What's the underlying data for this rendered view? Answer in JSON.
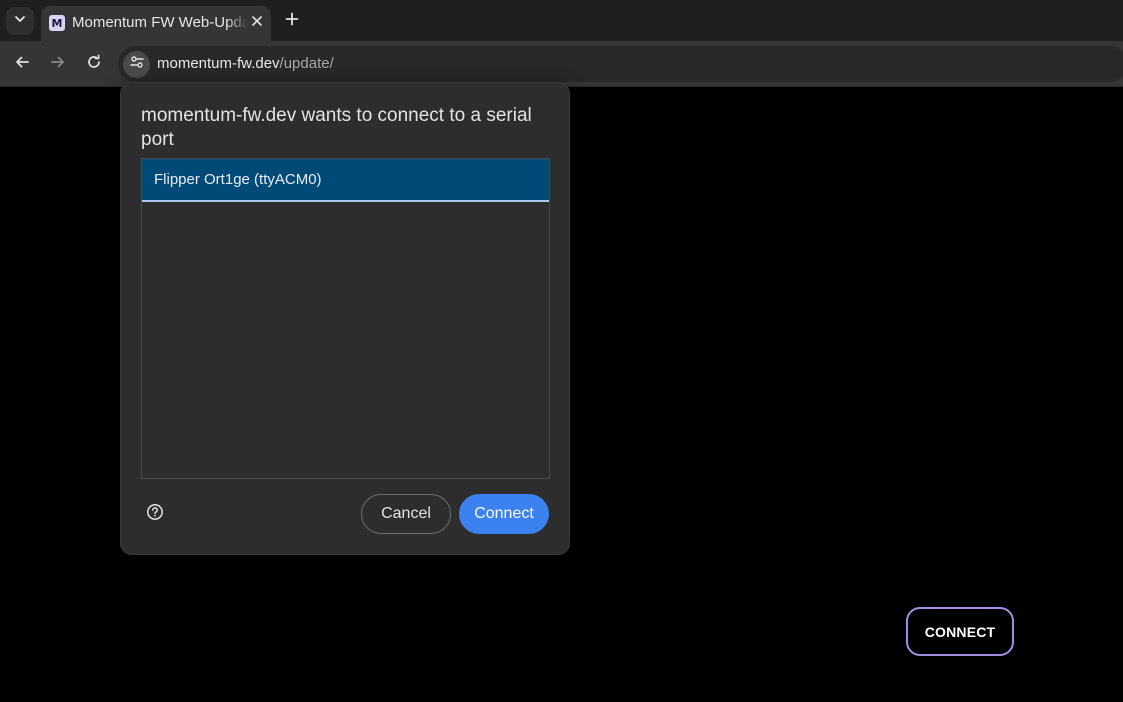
{
  "browser": {
    "tab": {
      "title": "Momentum FW Web-Updater",
      "favicon_letter": "M"
    },
    "address_bar": {
      "host": "momentum-fw.dev",
      "path": "/update/"
    }
  },
  "page": {
    "connect_button_label": "CONNECT"
  },
  "serial_dialog": {
    "title": "momentum-fw.dev wants to connect to a serial port",
    "ports": [
      {
        "label": "Flipper Ort1ge (ttyACM0)",
        "selected": true
      }
    ],
    "cancel_label": "Cancel",
    "connect_label": "Connect"
  },
  "colors": {
    "selected_row": "#004a77",
    "primary_button": "#3b82f0",
    "page_button_border": "#a48ee0"
  },
  "icons": [
    "chevron-down-icon",
    "favicon-icon",
    "close-icon",
    "plus-icon",
    "back-arrow-icon",
    "forward-arrow-icon",
    "reload-icon",
    "site-settings-icon",
    "help-icon"
  ]
}
